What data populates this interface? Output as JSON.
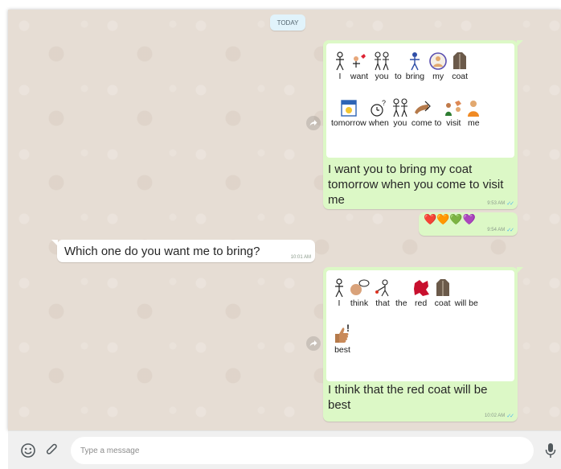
{
  "day_separator": "TODAY",
  "messages": {
    "m1": {
      "symbols_row1": [
        "I",
        "want",
        "you",
        "to",
        "bring",
        "my",
        "coat"
      ],
      "symbols_row2": [
        "tomorrow",
        "when",
        "you",
        "come",
        "to",
        "visit",
        "me"
      ],
      "text": "I want you to bring my  coat tomorrow when you come to visit me",
      "time": "9:53 AM"
    },
    "m2": {
      "emoji": "❤️🧡💚💜",
      "time": "9:54 AM"
    },
    "m3": {
      "text": "Which one do you want me to bring?",
      "time": "10:01 AM"
    },
    "m4": {
      "symbols_row1": [
        "I",
        "think",
        "that",
        "the",
        "red",
        "coat",
        "will be"
      ],
      "symbols_row2": [
        "best"
      ],
      "text": "I think that the red coat will be best",
      "time": "10:02 AM"
    }
  },
  "composer": {
    "placeholder": "Type a message"
  },
  "colors": {
    "outgoing_bubble": "#dcf8c6",
    "incoming_bubble": "#ffffff",
    "chat_background": "#e6ddd4",
    "read_ticks": "#4fb6ec"
  },
  "icons": {
    "emoji": "smiley-icon",
    "attach": "paperclip-icon",
    "voice": "microphone-icon",
    "forward": "forward-arrow-icon",
    "read": "double-check-icon"
  }
}
